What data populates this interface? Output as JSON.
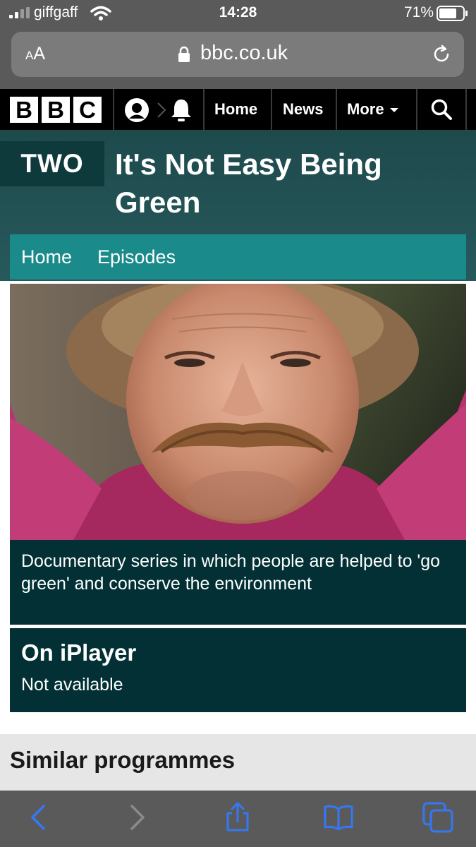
{
  "status_bar": {
    "carrier": "giffgaff",
    "time": "14:28",
    "battery": "71%"
  },
  "browser": {
    "text_size_small": "A",
    "text_size_large": "A",
    "url": "bbc.co.uk"
  },
  "bbc_nav": {
    "logo_letters": [
      "B",
      "B",
      "C"
    ],
    "home": "Home",
    "news": "News",
    "more": "More"
  },
  "channel": {
    "logo": "TWO"
  },
  "programme": {
    "title": "It's Not Easy Being Green",
    "nav": [
      "Home",
      "Episodes"
    ],
    "synopsis": "Documentary series in which people are helped to 'go green' and conserve the environment",
    "iplayer_heading": "On iPlayer",
    "iplayer_status": "Not available"
  },
  "similar": {
    "heading": "Similar programmes"
  },
  "colors": {
    "brand_bg": "#1e4a4c",
    "subnav": "#1a8a8a",
    "panel": "#023034",
    "ios_accent": "#3478f6"
  }
}
